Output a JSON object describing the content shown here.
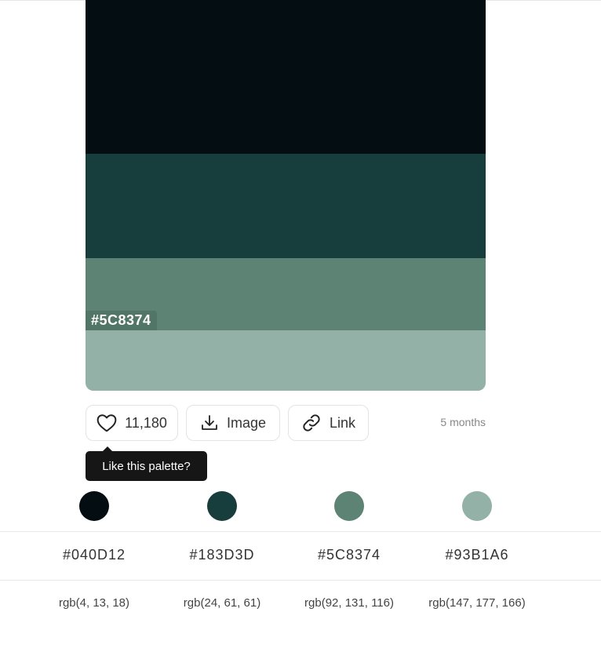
{
  "palette": {
    "colors": [
      {
        "hex": "#040D12",
        "rgb": "rgb(4, 13, 18)"
      },
      {
        "hex": "#183D3D",
        "rgb": "rgb(24, 61, 61)"
      },
      {
        "hex": "#5C8374",
        "rgb": "rgb(92, 131, 116)"
      },
      {
        "hex": "#93B1A6",
        "rgb": "rgb(147, 177, 166)"
      }
    ],
    "hover_label": "#5C8374"
  },
  "actions": {
    "like_count": "11,180",
    "image_label": "Image",
    "link_label": "Link",
    "date": "5 months",
    "tooltip": "Like this palette?"
  }
}
